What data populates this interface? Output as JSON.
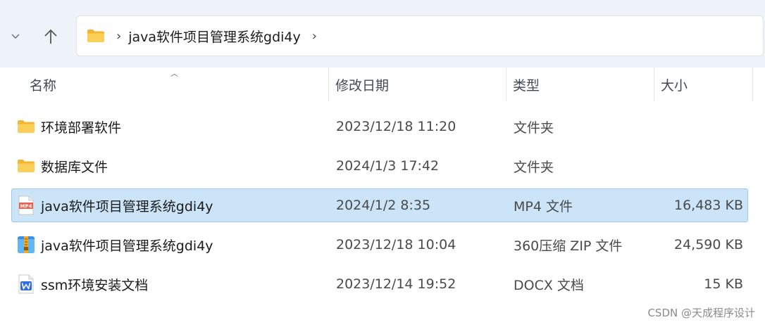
{
  "navigation": {
    "dropdown_icon": "chevron-down-icon",
    "up_icon": "arrow-up-icon",
    "address": {
      "folder_icon": "folder-icon",
      "path_segment": "java软件项目管理系统gdi4y"
    }
  },
  "columns": {
    "name": "名称",
    "date_modified": "修改日期",
    "type": "类型",
    "size": "大小"
  },
  "files": [
    {
      "icon": "folder-icon",
      "name": "环境部署软件",
      "date": "2023/12/18 11:20",
      "type": "文件夹",
      "size": "",
      "selected": false
    },
    {
      "icon": "folder-icon",
      "name": "数据库文件",
      "date": "2024/1/3 17:42",
      "type": "文件夹",
      "size": "",
      "selected": false
    },
    {
      "icon": "mp4-file-icon",
      "name": "java软件项目管理系统gdi4y",
      "date": "2024/1/2 8:35",
      "type": "MP4 文件",
      "size": "16,483 KB",
      "selected": true
    },
    {
      "icon": "zip-archive-icon",
      "name": "java软件项目管理系统gdi4y",
      "date": "2023/12/18 10:04",
      "type": "360压缩 ZIP 文件",
      "size": "24,590 KB",
      "selected": false
    },
    {
      "icon": "docx-file-icon",
      "name": "ssm环境安装文档",
      "date": "2023/12/14 19:52",
      "type": "DOCX 文档",
      "size": "15 KB",
      "selected": false
    }
  ],
  "mp4_icon_label": "MP4",
  "watermark": "CSDN @天成程序设计",
  "colors": {
    "selection_bg": "#cce4f7",
    "selection_border": "#99c9ef",
    "folder_yellow": "#f8c94b",
    "topbar_bg": "#eef3f9"
  }
}
